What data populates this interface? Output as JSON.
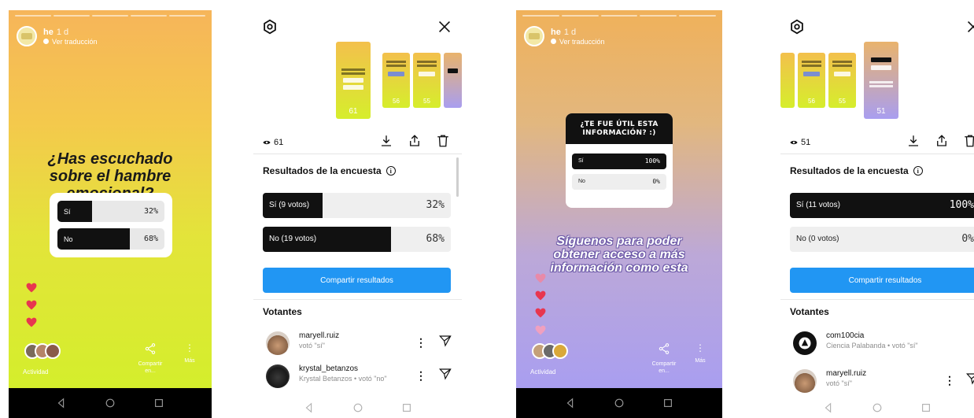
{
  "story1": {
    "user": "he",
    "time": "1 d",
    "translate_label": "Ver traducción",
    "question": "¿Has escuchado sobre el hambre emocional?",
    "options": [
      {
        "label": "Sí",
        "percent_text": "32%",
        "fill": 0.32
      },
      {
        "label": "No",
        "percent_text": "68%",
        "fill": 0.68
      }
    ],
    "activity_label": "Actividad",
    "share_label": "Compartir en...",
    "more_label": "Más"
  },
  "results1": {
    "views": "61",
    "thumb_counts": [
      "61",
      "56",
      "55"
    ],
    "section_title": "Resultados de la encuesta",
    "options": [
      {
        "label": "Sí (9 votos)",
        "percent_text": "32%",
        "fill": 0.32
      },
      {
        "label": "No (19 votos)",
        "percent_text": "68%",
        "fill": 0.68
      }
    ],
    "share_button": "Compartir resultados",
    "voters_title": "Votantes",
    "voters": [
      {
        "username": "maryell.ruiz",
        "detail": "votó \"sí\""
      },
      {
        "username": "krystal_betanzos",
        "detail": "Krystal Betanzos • votó \"no\""
      }
    ]
  },
  "story2": {
    "user": "he",
    "time": "1 d",
    "translate_label": "Ver traducción",
    "question": "¿TE FUE ÚTIL ESTA INFORMACIÓN? :)",
    "options": [
      {
        "label": "Sí",
        "percent_text": "100%",
        "fill": 1.0
      },
      {
        "label": "No",
        "percent_text": "0%",
        "fill": 0.0
      }
    ],
    "follow_text": "Síguenos para poder obtener acceso a más información como esta",
    "activity_label": "Actividad",
    "share_label": "Compartir en...",
    "more_label": "Más"
  },
  "results2": {
    "views": "51",
    "thumb_counts": [
      "56",
      "55",
      "51"
    ],
    "section_title": "Resultados de la encuesta",
    "options": [
      {
        "label": "Sí (11 votos)",
        "percent_text": "100%",
        "fill": 1.0
      },
      {
        "label": "No (0 votos)",
        "percent_text": "0%",
        "fill": 0.0
      }
    ],
    "share_button": "Compartir resultados",
    "voters_title": "Votantes",
    "voters": [
      {
        "username": "com100cia",
        "detail": "Ciencia Palabanda • votó \"sí\""
      },
      {
        "username": "maryell.ruiz",
        "detail": "votó \"sí\""
      }
    ]
  },
  "colors": {
    "accent_blue": "#2196f3",
    "heart_red": "#e8364f",
    "bar_black": "#111111"
  },
  "icons": [
    "settings-icon",
    "close-icon",
    "eye-icon",
    "download-icon",
    "share-icon",
    "trash-icon",
    "info-icon",
    "more-vertical-icon",
    "send-icon",
    "heart-icon",
    "back-nav-icon",
    "home-nav-icon",
    "recents-nav-icon"
  ]
}
